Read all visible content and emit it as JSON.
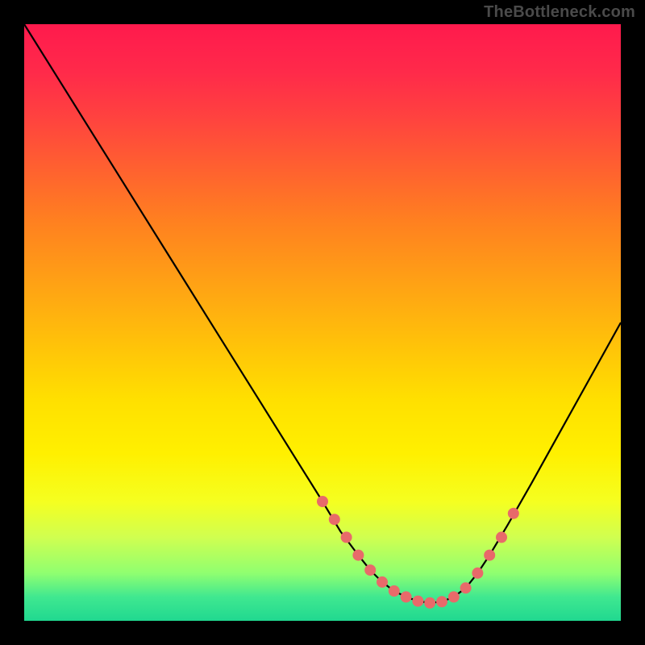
{
  "watermark": "TheBottleneck.com",
  "chart_data": {
    "type": "line",
    "title": "",
    "xlabel": "",
    "ylabel": "",
    "xlim": [
      0,
      100
    ],
    "ylim": [
      0,
      100
    ],
    "series": [
      {
        "name": "curve",
        "x": [
          0,
          5,
          10,
          15,
          20,
          25,
          30,
          35,
          40,
          45,
          50,
          53,
          56,
          58,
          60,
          62,
          64,
          66,
          68,
          70,
          72,
          74,
          76,
          78,
          81,
          85,
          90,
          95,
          100
        ],
        "y": [
          100,
          92,
          84,
          76,
          68,
          60,
          52,
          44,
          36,
          28,
          20,
          15,
          11,
          8.5,
          6.5,
          5,
          4,
          3.3,
          3,
          3.2,
          4,
          5.5,
          8,
          11,
          16,
          23,
          32,
          41,
          50
        ]
      }
    ],
    "markers": {
      "name": "highlight-points",
      "color": "#e86a6a",
      "x": [
        50,
        52,
        54,
        56,
        58,
        60,
        62,
        64,
        66,
        68,
        70,
        72,
        74,
        76,
        78,
        80,
        82
      ],
      "y": [
        20,
        17,
        14,
        11,
        8.5,
        6.5,
        5,
        4,
        3.3,
        3,
        3.2,
        4,
        5.5,
        8,
        11,
        14,
        18
      ]
    },
    "background": {
      "gradient_stops": [
        {
          "pos": 0,
          "color": "#ff1a4d"
        },
        {
          "pos": 50,
          "color": "#ffc000"
        },
        {
          "pos": 80,
          "color": "#f0ff30"
        },
        {
          "pos": 100,
          "color": "#20d890"
        }
      ]
    }
  }
}
